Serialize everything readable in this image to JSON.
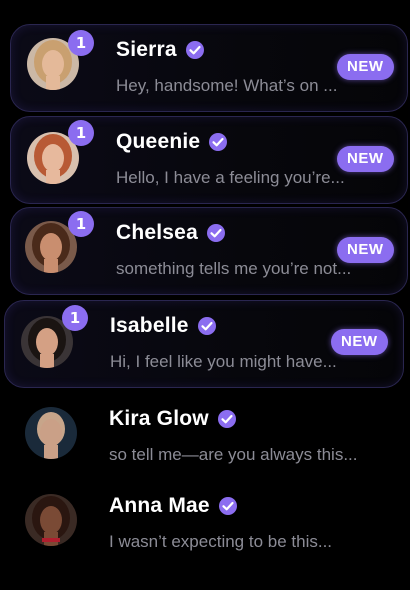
{
  "conversations": [
    {
      "name": "Sierra",
      "preview": "Hey, handsome! What’s on ...",
      "unread_count": "1",
      "new_label": "NEW",
      "verified": true,
      "avatar": {
        "hair": "#c9a070",
        "skin": "#e4b999",
        "bg": "#cbb8a6"
      }
    },
    {
      "name": "Queenie",
      "preview": "Hello, I have a feeling you’re...",
      "unread_count": "1",
      "new_label": "NEW",
      "verified": true,
      "avatar": {
        "hair": "#b85a35",
        "skin": "#e7b99d",
        "bg": "#d8c0ae"
      }
    },
    {
      "name": "Chelsea",
      "preview": "something tells me you’re not...",
      "unread_count": "1",
      "new_label": "NEW",
      "verified": true,
      "avatar": {
        "hair": "#4a2a1a",
        "skin": "#c98e6f",
        "bg": "#7a5a4a"
      }
    },
    {
      "name": "Isabelle",
      "preview": "Hi, I feel like you might have...",
      "unread_count": "1",
      "new_label": "NEW",
      "verified": true,
      "avatar": {
        "hair": "#1a1412",
        "skin": "#d4a084",
        "bg": "#3a3436"
      }
    },
    {
      "name": "Kira Glow",
      "preview": "so tell me—are you always this...",
      "unread_count": "",
      "new_label": "",
      "verified": true,
      "avatar": {
        "hair": "#c7a58a",
        "skin": "#caa087",
        "bg": "#1a2a3a"
      }
    },
    {
      "name": "Anna Mae",
      "preview": "I wasn’t expecting to be this...",
      "unread_count": "",
      "new_label": "",
      "verified": true,
      "avatar": {
        "hair": "#2a1610",
        "skin": "#7a4a35",
        "bg": "#3a2a24"
      }
    }
  ],
  "colors": {
    "accent": "#8b6df0",
    "card_border": "#2a2650",
    "preview_text": "#8c8c96",
    "name_text": "#ffffff"
  }
}
